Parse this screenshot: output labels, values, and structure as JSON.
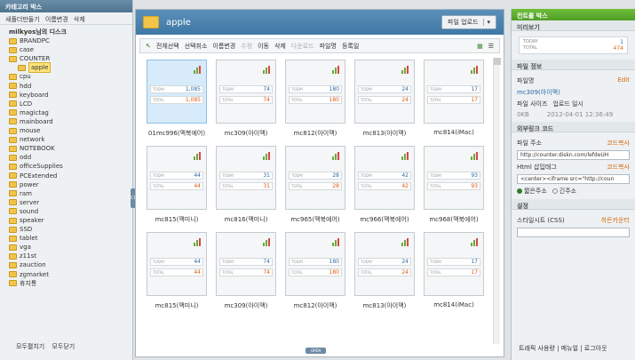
{
  "left": {
    "title": "카테고리 박스",
    "tools": [
      "새폴더만들기",
      "이름변경",
      "삭제"
    ],
    "root": "milkyos님의 디스크",
    "folders": [
      "BRANDPC",
      "case",
      "COUNTER",
      "apple",
      "cpu",
      "hdd",
      "keyboard",
      "LCD",
      "magictag",
      "mainboard",
      "mouse",
      "network",
      "NOTEBOOK",
      "odd",
      "officeSupplies",
      "PCExtended",
      "power",
      "ram",
      "server",
      "sound",
      "speaker",
      "SSD",
      "tablet",
      "vga",
      "z11st",
      "zauction",
      "zgmarket",
      "휴지통"
    ],
    "selected_folder": "apple",
    "footer": [
      "모두펼치기",
      "모두닫기"
    ],
    "toggle_label": "CLOSE"
  },
  "center": {
    "title": "apple",
    "upload_label": "파일 업로드",
    "toolbar": {
      "select_all": "전체선택",
      "deselect": "선택취소",
      "rename": "이름변경",
      "edit": "수정",
      "move": "이동",
      "delete": "삭제",
      "download": "다운로드",
      "sort_name": "파일명",
      "sort_date": "등록일"
    },
    "cards": [
      {
        "caption": "01mc996(맥북에어)",
        "today": "1,085",
        "total": "1,085",
        "selected": true
      },
      {
        "caption": "mc309(아이맥)",
        "today": "74",
        "total": "74"
      },
      {
        "caption": "mc812(아이맥)",
        "today": "180",
        "total": "180"
      },
      {
        "caption": "mc813(아이맥)",
        "today": "24",
        "total": "24"
      },
      {
        "caption": "mc814(iMac)",
        "today": "17",
        "total": "17"
      },
      {
        "caption": "mc815(맥미니)",
        "today": "44",
        "total": "44"
      },
      {
        "caption": "mc816(맥미니)",
        "today": "31",
        "total": "31"
      },
      {
        "caption": "mc965(맥북에어)",
        "today": "28",
        "total": "28"
      },
      {
        "caption": "mc966(맥북에어)",
        "today": "42",
        "total": "42"
      },
      {
        "caption": "mc968(맥북에어)",
        "today": "93",
        "total": "93"
      },
      {
        "caption": "mc815(맥미니)",
        "today": "44",
        "total": "44"
      },
      {
        "caption": "mc309(아이맥)",
        "today": "74",
        "total": "74"
      },
      {
        "caption": "mc812(아이맥)",
        "today": "180",
        "total": "180"
      },
      {
        "caption": "mc813(아이맥)",
        "today": "24",
        "total": "24"
      },
      {
        "caption": "mc814(iMac)",
        "today": "17",
        "total": "17"
      }
    ],
    "today_label": "TODAY",
    "total_label": "TOTAL",
    "open_label": "OPEN"
  },
  "right": {
    "title": "컨트롤 박스",
    "preview": {
      "title": "미리보기",
      "today_label": "TODAY",
      "today": "1",
      "total_label": "TOTAL",
      "total": "474"
    },
    "info": {
      "title": "파일 정보",
      "name_label": "파일명",
      "edit_label": "Edit",
      "name_value": "mc309(아이맥)",
      "size_label": "파일 사이즈",
      "date_label": "업로드 일시",
      "size_value": "0KB",
      "date_value": "2012-04-01 12:36:49"
    },
    "link": {
      "title": "외부링크 코드",
      "addr_label": "파일 주소",
      "copy_label": "코드복사",
      "addr_value": "http://counter.diskn.com/lefdeUH",
      "html_label": "Html 삽입태그",
      "html_value": "<center><iframe src=\"http://coun",
      "radio1": "짧은주소",
      "radio2": "긴주소"
    },
    "settings": {
      "title": "설정",
      "style_label": "스타일시트 (CSS)",
      "hide_label": "하든카운터"
    },
    "footer": "트래픽 사용량 | 메뉴얼 | 로그아웃"
  }
}
